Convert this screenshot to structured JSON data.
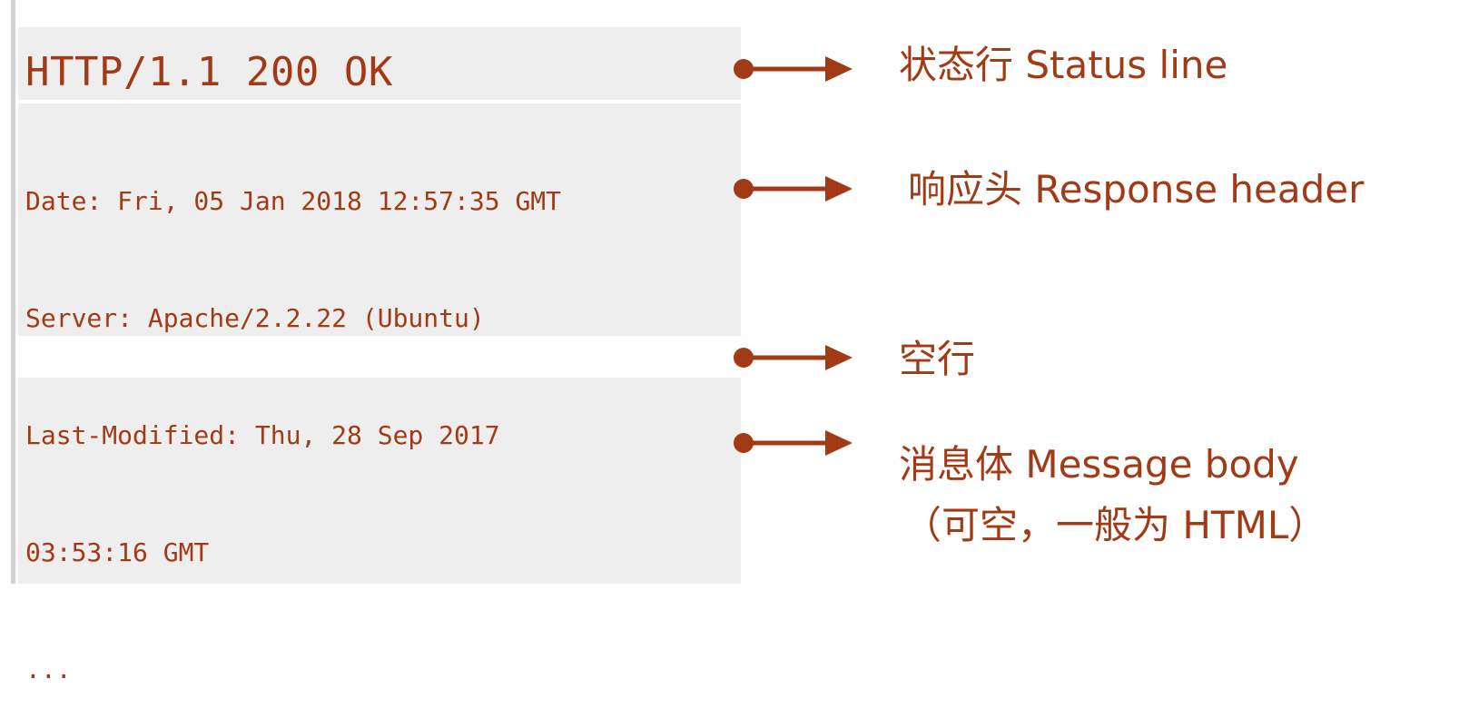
{
  "message": {
    "status_line": "HTTP/1.1 200 OK",
    "header_lines": [
      "Date: Fri, 05 Jan 2018 12:57:35 GMT",
      "Server: Apache/2.2.22 (Ubuntu)",
      "Last-Modified: Thu, 28 Sep 2017",
      "03:53:16 GMT",
      "..."
    ]
  },
  "annotations": {
    "status_line": "状态行 Status line",
    "response_header": "响应头 Response header",
    "empty_line": "空行",
    "message_body": "消息体 Message body",
    "message_body_note": "（可空，一般为 HTML）"
  },
  "colors": {
    "accent": "#a23b15",
    "block_bg": "#eeeeee",
    "rule": "#d2d2d2"
  }
}
